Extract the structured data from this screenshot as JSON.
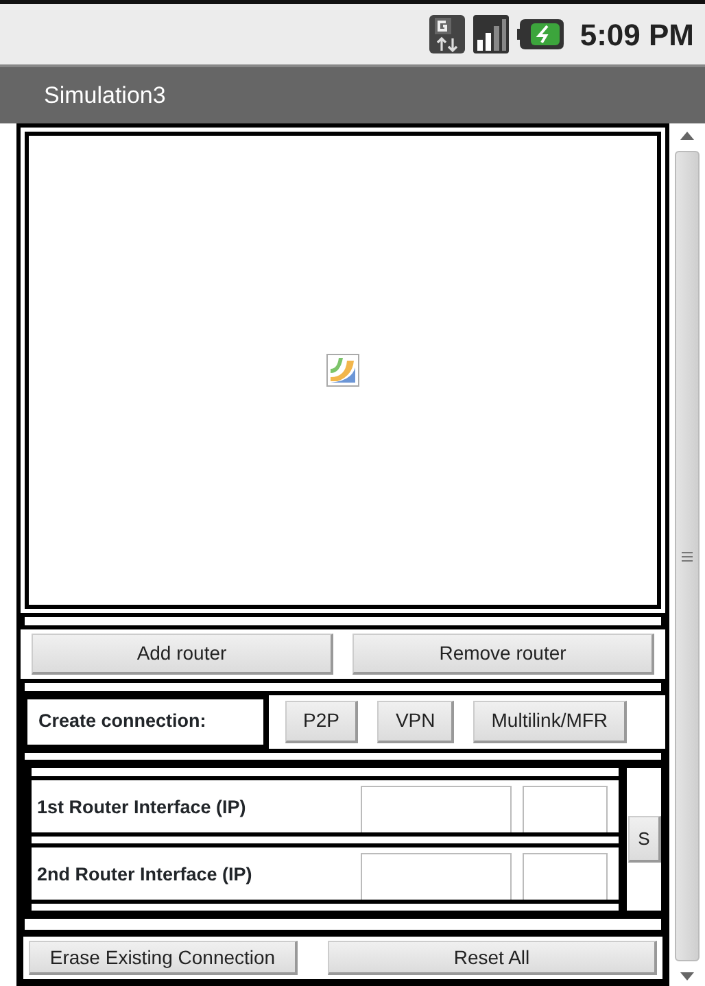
{
  "status_bar": {
    "time": "5:09 PM"
  },
  "title": "Simulation3",
  "router_buttons": [
    "Add router",
    "Remove router"
  ],
  "connection": {
    "label": "Create connection:",
    "buttons": [
      "P2P",
      "VPN",
      "Multilink/MFR"
    ]
  },
  "interfaces": [
    {
      "label": "1st Router Interface (IP)"
    },
    {
      "label": "2nd Router Interface (IP)"
    }
  ],
  "side_button": "S",
  "bottom_buttons": [
    "Erase Existing Connection",
    "Reset All"
  ]
}
